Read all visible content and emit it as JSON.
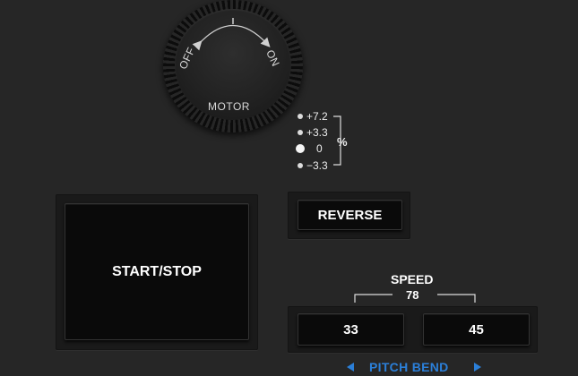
{
  "motor_knob": {
    "label": "MOTOR",
    "off_label": "OFF",
    "on_label": "ON"
  },
  "speed_indicator": {
    "levels": [
      "+7.2",
      "+3.3",
      "0",
      "−3.3"
    ],
    "active_level": "0",
    "unit": "%"
  },
  "buttons": {
    "start_stop": "START/STOP",
    "reverse": "REVERSE",
    "speed_33": "33",
    "speed_45": "45"
  },
  "speed_section": {
    "title": "SPEED",
    "combined": "78"
  },
  "pitch_bend": {
    "label": "PITCH BEND",
    "left_arrow_icon": "triangle-left-icon",
    "right_arrow_icon": "triangle-right-icon",
    "color": "#2b7fd8"
  }
}
